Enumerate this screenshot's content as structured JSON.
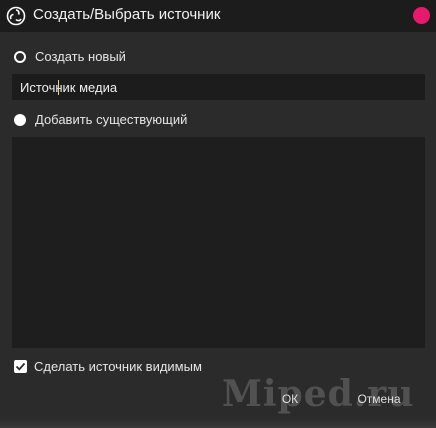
{
  "window": {
    "title": "Создать/Выбрать источник"
  },
  "options": {
    "create_new_label": "Создать новый",
    "source_name_value": "Источник медиа",
    "add_existing_label": "Добавить существующий"
  },
  "visibility": {
    "label": "Сделать источник видимым",
    "checked": true
  },
  "buttons": {
    "ok_label": "ОК",
    "cancel_label": "Отмена"
  },
  "watermark": {
    "text": "Miped.ru"
  },
  "colors": {
    "accent_close": "#e8196a",
    "background": "#2b2b2b",
    "input_bg": "#1c1c1c"
  },
  "icons": {
    "app": "obs-logo-icon",
    "close": "close-dot-icon",
    "check": "check-icon"
  }
}
